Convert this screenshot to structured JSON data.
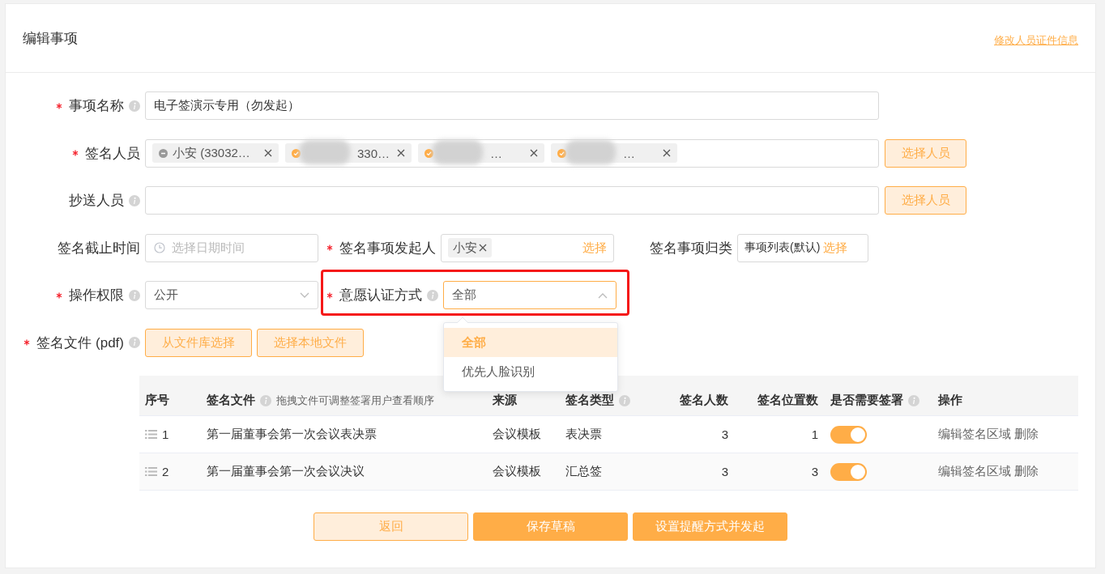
{
  "header": {
    "title": "编辑事项",
    "link": "修改人员证件信息"
  },
  "form_rows": [
    [
      {
        "kind": "text",
        "label": "事项名称",
        "required": true,
        "info": true,
        "value": "电子签演示专用（勿发起）"
      }
    ],
    [
      {
        "kind": "tags",
        "label": "签名人员",
        "required": true,
        "info": false,
        "button": "选择人员",
        "tags": [
          {
            "text": "小安 (33032…",
            "verified": false,
            "redacted": false
          },
          {
            "text": "330…",
            "verified": true,
            "redacted": true
          },
          {
            "text": "…",
            "verified": true,
            "redacted": true
          },
          {
            "text": "…",
            "verified": true,
            "redacted": true
          }
        ]
      }
    ],
    [
      {
        "kind": "tags",
        "label": "抄送人员",
        "required": false,
        "info": true,
        "button": "选择人员"
      }
    ],
    [
      {
        "kind": "date",
        "label": "签名截止时间",
        "required": false,
        "info": false,
        "placeholder": "选择日期时间"
      },
      {
        "kind": "picker",
        "label": "签名事项发起人",
        "required": true,
        "info": false,
        "tag": "小安",
        "action": "选择"
      },
      {
        "kind": "category",
        "label": "签名事项归类",
        "required": false,
        "info": false,
        "value": "事项列表(默认)",
        "action": "选择"
      }
    ],
    [
      {
        "kind": "select",
        "label": "操作权限",
        "required": true,
        "info": true,
        "value": "公开",
        "open": false,
        "highlighted": false
      },
      {
        "kind": "select",
        "label": "意愿认证方式",
        "required": true,
        "info": true,
        "value": "全部",
        "open": true,
        "highlighted": true,
        "options": [
          {
            "label": "全部",
            "selected": true
          },
          {
            "label": "优先人脸识别",
            "selected": false
          }
        ]
      }
    ],
    [
      {
        "kind": "buttons",
        "label": "签名文件 (pdf)",
        "required": true,
        "info": true,
        "buttons": [
          "从文件库选择",
          "选择本地文件"
        ]
      }
    ]
  ],
  "table": {
    "columns": [
      {
        "label": "序号",
        "info": false
      },
      {
        "label": "签名文件",
        "info": true,
        "hint": "拖拽文件可调整签署用户查看顺序"
      },
      {
        "label": "来源",
        "info": false
      },
      {
        "label": "签名类型",
        "info": true
      },
      {
        "label": "签名人数",
        "info": false
      },
      {
        "label": "签名位置数",
        "info": false
      },
      {
        "label": "是否需要签署",
        "info": true
      },
      {
        "label": "操作",
        "info": false
      }
    ],
    "rows": [
      {
        "index": "1",
        "file": "第一届董事会第一次会议表决票",
        "source": "会议模板",
        "type": "表决票",
        "signers": "3",
        "positions": "1",
        "needs_sign": true,
        "actions": [
          "编辑签名区域",
          "删除"
        ]
      },
      {
        "index": "2",
        "file": "第一届董事会第一次会议决议",
        "source": "会议模板",
        "type": "汇总签",
        "signers": "3",
        "positions": "3",
        "needs_sign": true,
        "actions": [
          "编辑签名区域",
          "删除"
        ]
      }
    ]
  },
  "buttons": [
    {
      "label": "返回",
      "kind": "light"
    },
    {
      "label": "保存草稿",
      "kind": "primary"
    },
    {
      "label": "设置提醒方式并发起",
      "kind": "primary"
    }
  ]
}
